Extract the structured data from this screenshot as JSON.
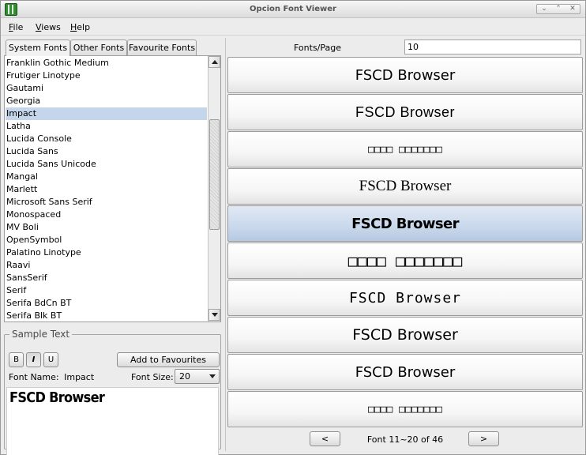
{
  "window": {
    "title": "Opcion Font Viewer"
  },
  "menu": [
    {
      "mnemonic": "F",
      "rest": "ile"
    },
    {
      "mnemonic": "V",
      "rest": "iews"
    },
    {
      "mnemonic": "H",
      "rest": "elp"
    }
  ],
  "tabs": [
    "System Fonts",
    "Other Fonts",
    "Favourite Fonts"
  ],
  "font_list": {
    "items": [
      "Franklin Gothic Medium",
      "Frutiger Linotype",
      "Gautami",
      "Georgia",
      "Impact",
      "Latha",
      "Lucida Console",
      "Lucida Sans",
      "Lucida Sans Unicode",
      "Mangal",
      "Marlett",
      "Microsoft Sans Serif",
      "Monospaced",
      "MV Boli",
      "OpenSymbol",
      "Palatino Linotype",
      "Raavi",
      "SansSerif",
      "Serif",
      "Serifa BdCn BT",
      "Serifa Blk BT"
    ],
    "selected": "Impact"
  },
  "sample": {
    "legend": "Sample Text",
    "bold_label": "B",
    "italic_label": "I",
    "underline_label": "U",
    "add_favourites_label": "Add to Favourites",
    "font_name_label": "Font Name:",
    "font_name_value": "Impact",
    "font_size_label": "Font Size:",
    "font_size_value": "20",
    "preview_text": "FSCD Browser"
  },
  "fonts_per_page": {
    "label": "Fonts/Page",
    "value": "10"
  },
  "preview_rows": [
    {
      "text": "FSCD Browser",
      "selected": false
    },
    {
      "text": "FSCD Browser",
      "selected": false
    },
    {
      "text": "□□□□ □□□□□□□",
      "selected": false
    },
    {
      "text": "FSCD Browser",
      "selected": false
    },
    {
      "text": "FSCD Browser",
      "selected": true
    },
    {
      "text": "□□□□ □□□□□□□",
      "selected": false
    },
    {
      "text": "FSCD Browser",
      "selected": false
    },
    {
      "text": "FSCD Browser",
      "selected": false
    },
    {
      "text": "FSCD Browser",
      "selected": false
    },
    {
      "text": "□□□□ □□□□□□□",
      "selected": false
    }
  ],
  "pager": {
    "prev_label": "<",
    "status": "Font 11~20 of 46",
    "next_label": ">"
  }
}
